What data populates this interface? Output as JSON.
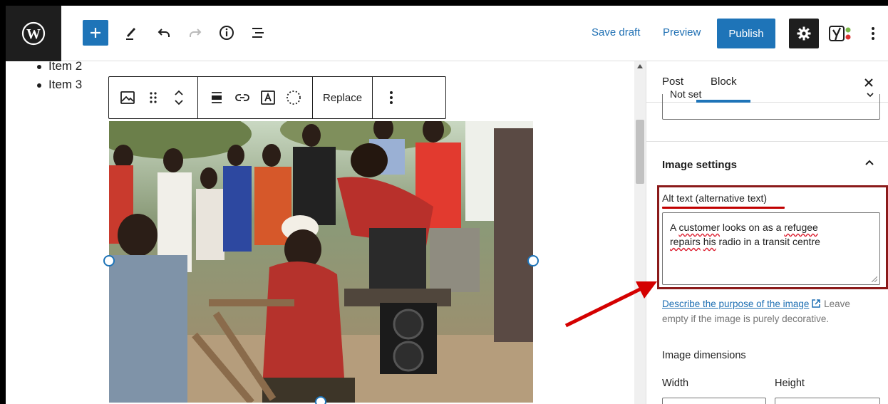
{
  "header": {
    "save_draft": "Save draft",
    "preview": "Preview",
    "publish": "Publish",
    "icons": [
      "wordpress-logo-icon",
      "plus-icon",
      "pencil-icon",
      "undo-icon",
      "redo-icon",
      "info-icon",
      "list-view-icon",
      "gear-icon",
      "yoast-icon",
      "more-vertical-icon"
    ]
  },
  "canvas": {
    "list_items": [
      "Item 2",
      "Item 3"
    ],
    "block_toolbar": {
      "replace": "Replace",
      "icons": [
        "image-icon",
        "drag-handle-icon",
        "move-up-down-icon",
        "align-icon",
        "link-icon",
        "text-overlay-icon",
        "select-circle-icon",
        "more-vertical-icon"
      ]
    },
    "image_description": "photo"
  },
  "sidebar": {
    "tabs": [
      "Post",
      "Block"
    ],
    "active_tab": "Block",
    "select_value": "Not set",
    "image_settings_title": "Image settings",
    "alt_label": "Alt text (alternative text)",
    "alt_text": {
      "p1": "A ",
      "w1": "customer",
      "p2": " looks on as a ",
      "w2": "refugee",
      "w3": "repairs",
      "p3": " ",
      "w4": "his",
      "p4": " radio in a transit centre"
    },
    "describe_link": "Describe the purpose of the image",
    "describe_rest": " Leave empty if the image is purely decorative.",
    "dimensions_title": "Image dimensions",
    "width_label": "Width",
    "height_label": "Height"
  },
  "colors": {
    "accent": "#1e74b8",
    "highlight": "#8b1a1a",
    "arrow": "#d40000"
  }
}
